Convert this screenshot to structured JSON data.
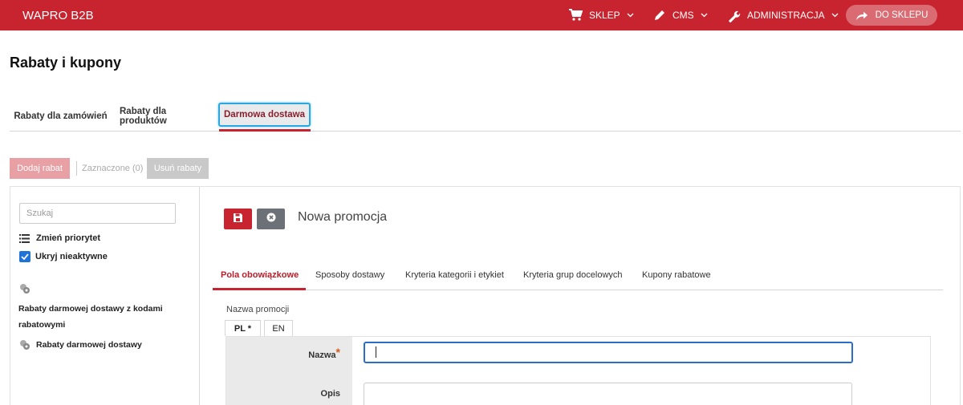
{
  "topbar": {
    "brand": "WAPRO B2B",
    "nav": [
      {
        "label": "SKLEP",
        "icon": "cart-icon"
      },
      {
        "label": "CMS",
        "icon": "pencil-icon"
      },
      {
        "label": "ADMINISTRACJA",
        "icon": "wrench-icon"
      }
    ],
    "store_button": "DO SKLEPU",
    "accent": "#c8242f"
  },
  "page": {
    "title": "Rabaty i kupony"
  },
  "tabs": [
    "Rabaty dla zamówień",
    "Rabaty dla produktów",
    "Darmowa dostawa"
  ],
  "toolbar": {
    "add_label": "Dodaj rabat",
    "selected_label": "Zaznaczone (0)",
    "remove_label": "Usuń rabaty"
  },
  "sidebar": {
    "search_placeholder": "Szukaj",
    "priority_label": "Zmień priorytet",
    "hide_inactive_label": "Ukryj nieaktywne",
    "hide_inactive_checked": true,
    "tree": [
      "Rabaty darmowej dostawy z kodami rabatowymi",
      "Rabaty darmowej dostawy"
    ]
  },
  "editor": {
    "title": "Nowa promocja",
    "subtabs": [
      "Pola obowiązkowe",
      "Sposoby dostawy",
      "Kryteria kategorii i etykiet",
      "Kryteria grup docelowych",
      "Kupony rabatowe"
    ],
    "field_group_label": "Nazwa promocji",
    "languages": [
      "PL *",
      "EN"
    ],
    "name_label": "Nazwa",
    "required_mark": "*",
    "name_value": "",
    "description_label": "Opis"
  }
}
